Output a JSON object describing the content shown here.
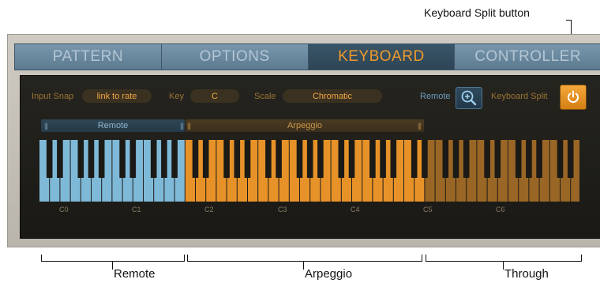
{
  "callout": {
    "keyboard_split_button": "Keyboard Split button"
  },
  "tabs": [
    "PATTERN",
    "OPTIONS",
    "KEYBOARD",
    "CONTROLLER"
  ],
  "active_tab": "KEYBOARD",
  "toolbar": {
    "input_snap_label": "Input Snap",
    "input_snap_value": "link to rate",
    "key_label": "Key",
    "key_value": "C",
    "scale_label": "Scale",
    "scale_value": "Chromatic",
    "remote_label": "Remote",
    "keyboard_split_label": "Keyboard Split"
  },
  "zones": {
    "remote": "Remote",
    "arpeggio": "Arpeggio"
  },
  "octave_labels": [
    "C0",
    "C1",
    "C2",
    "C3",
    "C4",
    "C5",
    "C6"
  ],
  "bottom_labels": {
    "remote": "Remote",
    "arpeggio": "Arpeggio",
    "through": "Through"
  },
  "colors": {
    "remote_zone": "#7fb9d8",
    "arpeggio_zone": "#e79228",
    "through_zone": "#9a6625",
    "accent": "#f09a2a"
  },
  "icons": {
    "zoom": "zoom-in-icon",
    "power": "power-icon"
  }
}
